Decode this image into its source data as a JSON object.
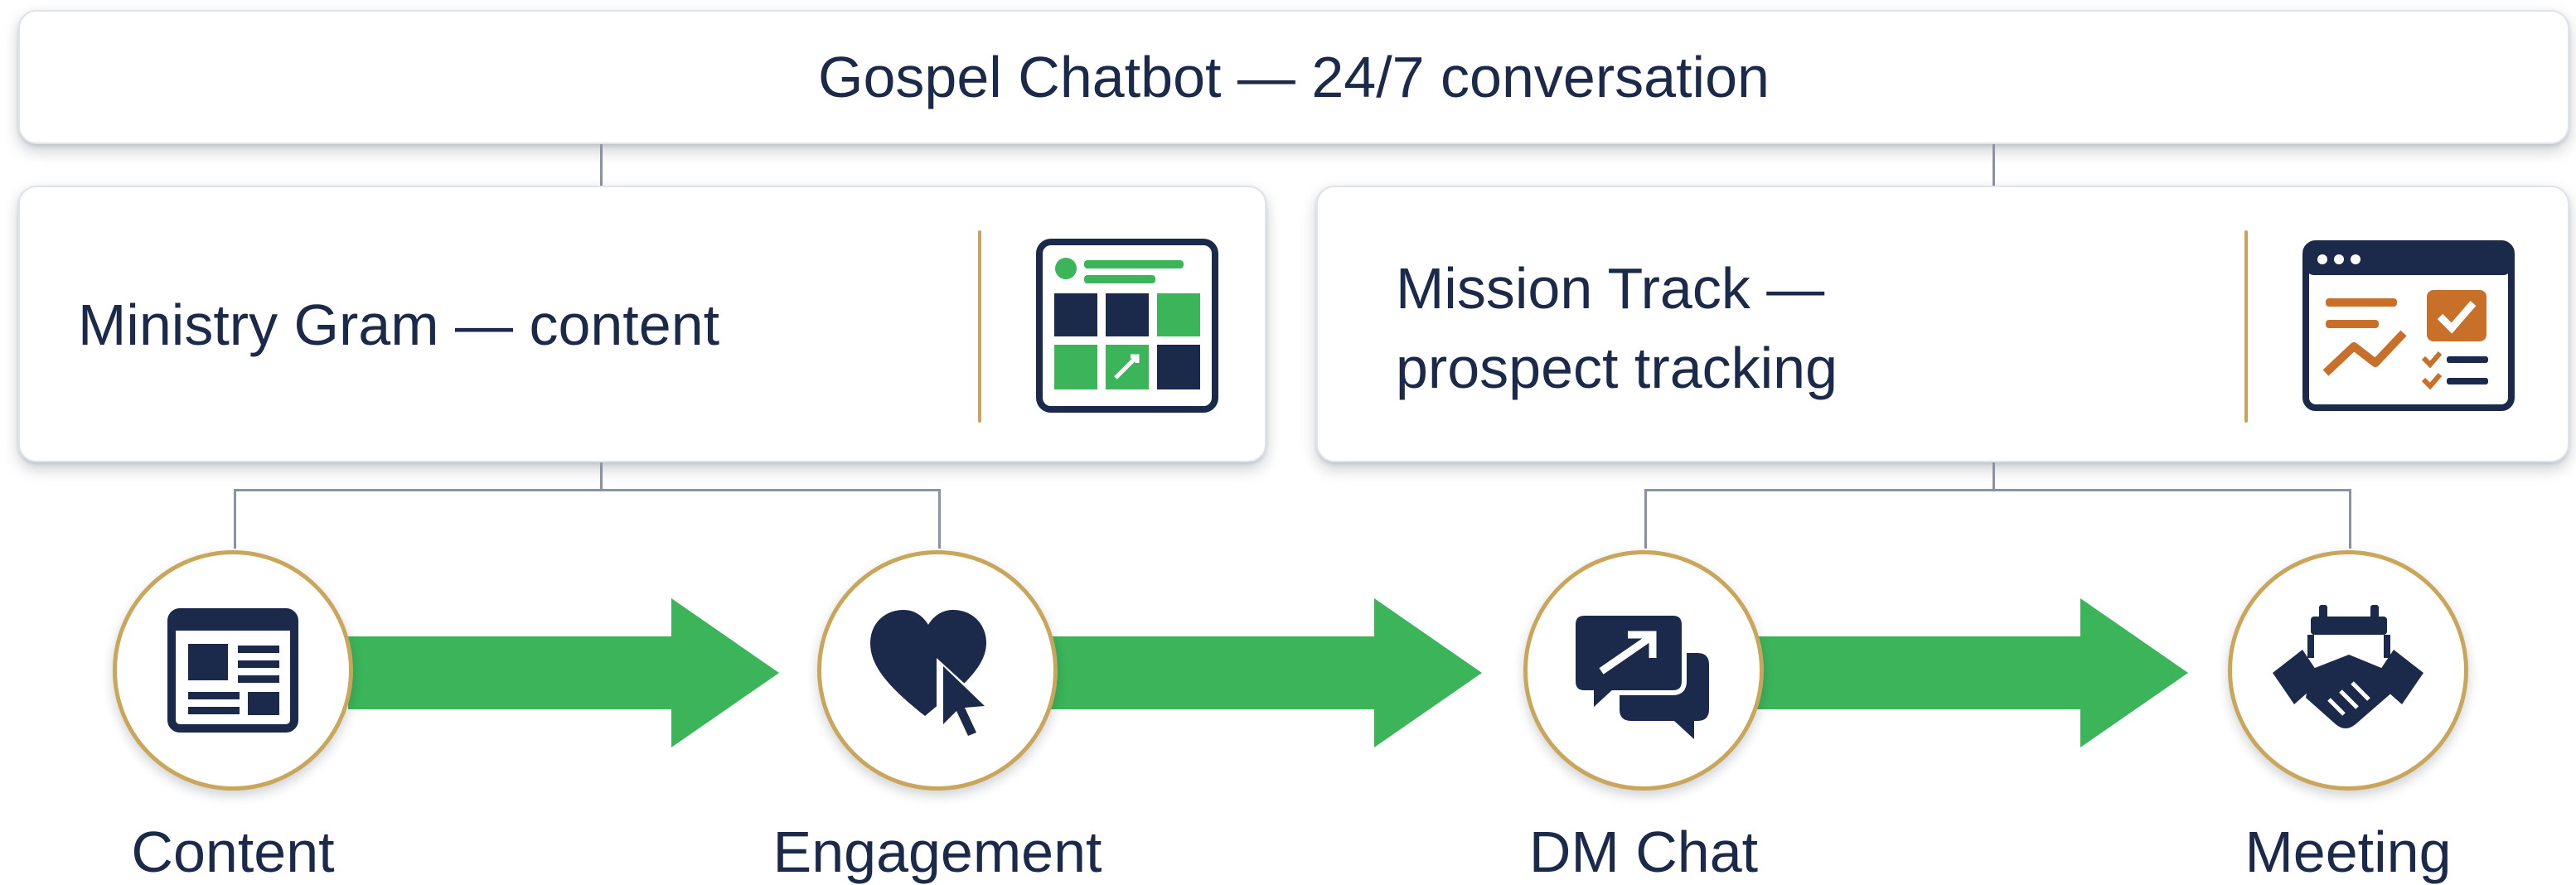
{
  "header": {
    "title": "Gospel Chatbot — 24/7 conversation"
  },
  "cards": [
    {
      "title": "Ministry Gram — content",
      "icon": "content-grid-icon"
    },
    {
      "title_line1": "Mission Track —",
      "title_line2": "prospect tracking",
      "icon": "analytics-dashboard-icon"
    }
  ],
  "stages": [
    {
      "label": "Content",
      "icon": "article-layout-icon"
    },
    {
      "label": "Engagement",
      "icon": "heart-cursor-icon"
    },
    {
      "label": "DM Chat",
      "icon": "chat-bubbles-icon"
    },
    {
      "label": "Meeting",
      "icon": "handshake-calendar-icon"
    }
  ],
  "colors": {
    "navy": "#1b2a4a",
    "green": "#3cb55a",
    "gold": "#c9a65a",
    "orange": "#c8702a",
    "connector": "#8a93a2"
  }
}
